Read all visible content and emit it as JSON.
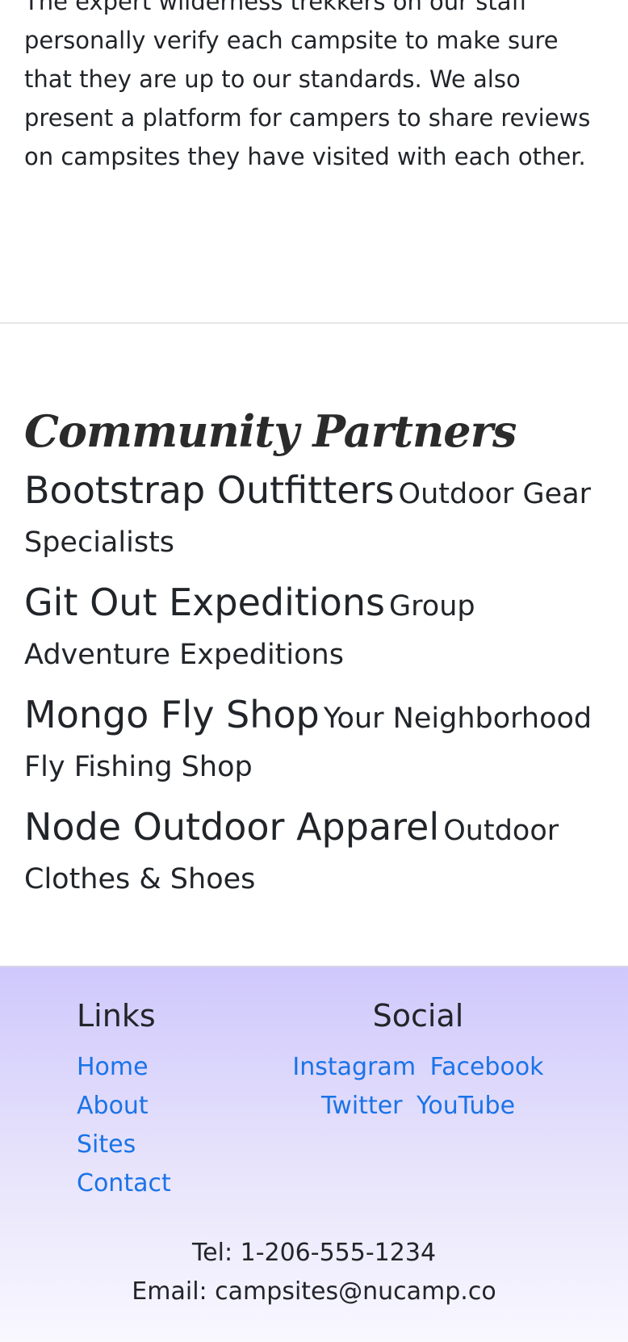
{
  "intro": {
    "text": "The expert wilderness trekkers on our staff personally verify each campsite to make sure that they are up to our standards. We also present a platform for campers to share reviews on campsites they have visited with each other."
  },
  "partners": {
    "heading": "Community Partners",
    "items": [
      {
        "name": "Bootstrap Outfitters",
        "desc": "Outdoor Gear Specialists"
      },
      {
        "name": "Git Out Expeditions",
        "desc": "Group Adventure Expeditions"
      },
      {
        "name": "Mongo Fly Shop",
        "desc": "Your Neighborhood Fly Fishing Shop"
      },
      {
        "name": "Node Outdoor Apparel",
        "desc": "Outdoor Clothes & Shoes"
      }
    ]
  },
  "footer": {
    "links_heading": "Links",
    "links": [
      "Home",
      "About",
      "Sites",
      "Contact"
    ],
    "social_heading": "Social",
    "social": [
      "Instagram",
      "Facebook",
      "Twitter",
      "YouTube"
    ],
    "tel": "Tel: 1-206-555-1234",
    "email": "Email: campsites@nucamp.co"
  },
  "colors": {
    "link": "#1a73e8",
    "footer_top": "#cfc8fc",
    "footer_bottom": "#f9f8ff"
  }
}
